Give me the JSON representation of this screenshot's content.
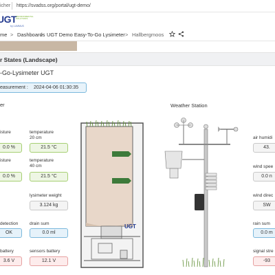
{
  "browser": {
    "security_label": "icher",
    "url": "https://svadss.org/portal/ugt-demo/"
  },
  "logo": {
    "text": "UGT",
    "tagline": "ENVIRONMENTAL SOLUTIONS",
    "sub": "by LUMMUS"
  },
  "breadcrumb": {
    "home": "me",
    "sep1": ">",
    "dashboards": "Dashboards",
    "sep2": ">",
    "demo": "UGT Demo Easy-To-Go Lysimeter",
    "sep3": ">",
    "location": "Hallbergmoos",
    "star_icon": "star-icon",
    "share_icon": "share-icon"
  },
  "panel": {
    "title": "r States (Landscape)",
    "subtitle": "-Go-Lysimeter UGT",
    "last_measurement_label": "easurement :",
    "last_measurement_value": "2024-04-06 01:30:35"
  },
  "lysimeter": {
    "section_title": "er",
    "rows": [
      {
        "left_label": "isture",
        "left_value": "0.0 %",
        "right_label": "temperature\n20 cm",
        "right_value": "21.5 °C"
      },
      {
        "left_label": "isture",
        "left_value": "0.0 %",
        "right_label": "temperature\n40 cm",
        "right_value": "21.5 °C"
      },
      {
        "right_label": "lysimeter weight",
        "right_value": "3.124 kg"
      },
      {
        "left_label": "detection",
        "left_value": "OK",
        "right_label": "drain sum",
        "right_value": "0.0 ml"
      },
      {
        "left_label": "battery",
        "left_value": "3.6 V",
        "right_label": "sensors battery",
        "right_value": "12.1 V"
      }
    ],
    "device_label": "UGT"
  },
  "weather": {
    "section_title": "Weather Station",
    "items": [
      {
        "label": "air humidi",
        "value": "43."
      },
      {
        "label": "wind spee",
        "value": "0.0 n"
      },
      {
        "label": "wind direc",
        "value": "SW"
      },
      {
        "label": "rain sum",
        "value": "0.0 m"
      },
      {
        "label": "signal stre",
        "value": "-93"
      }
    ]
  },
  "colors": {
    "ok": "#a5cf71",
    "neutral": "#c8c8c8",
    "info": "#7ab8dc",
    "alert": "#e6a0a0",
    "brand": "#233a8f"
  }
}
